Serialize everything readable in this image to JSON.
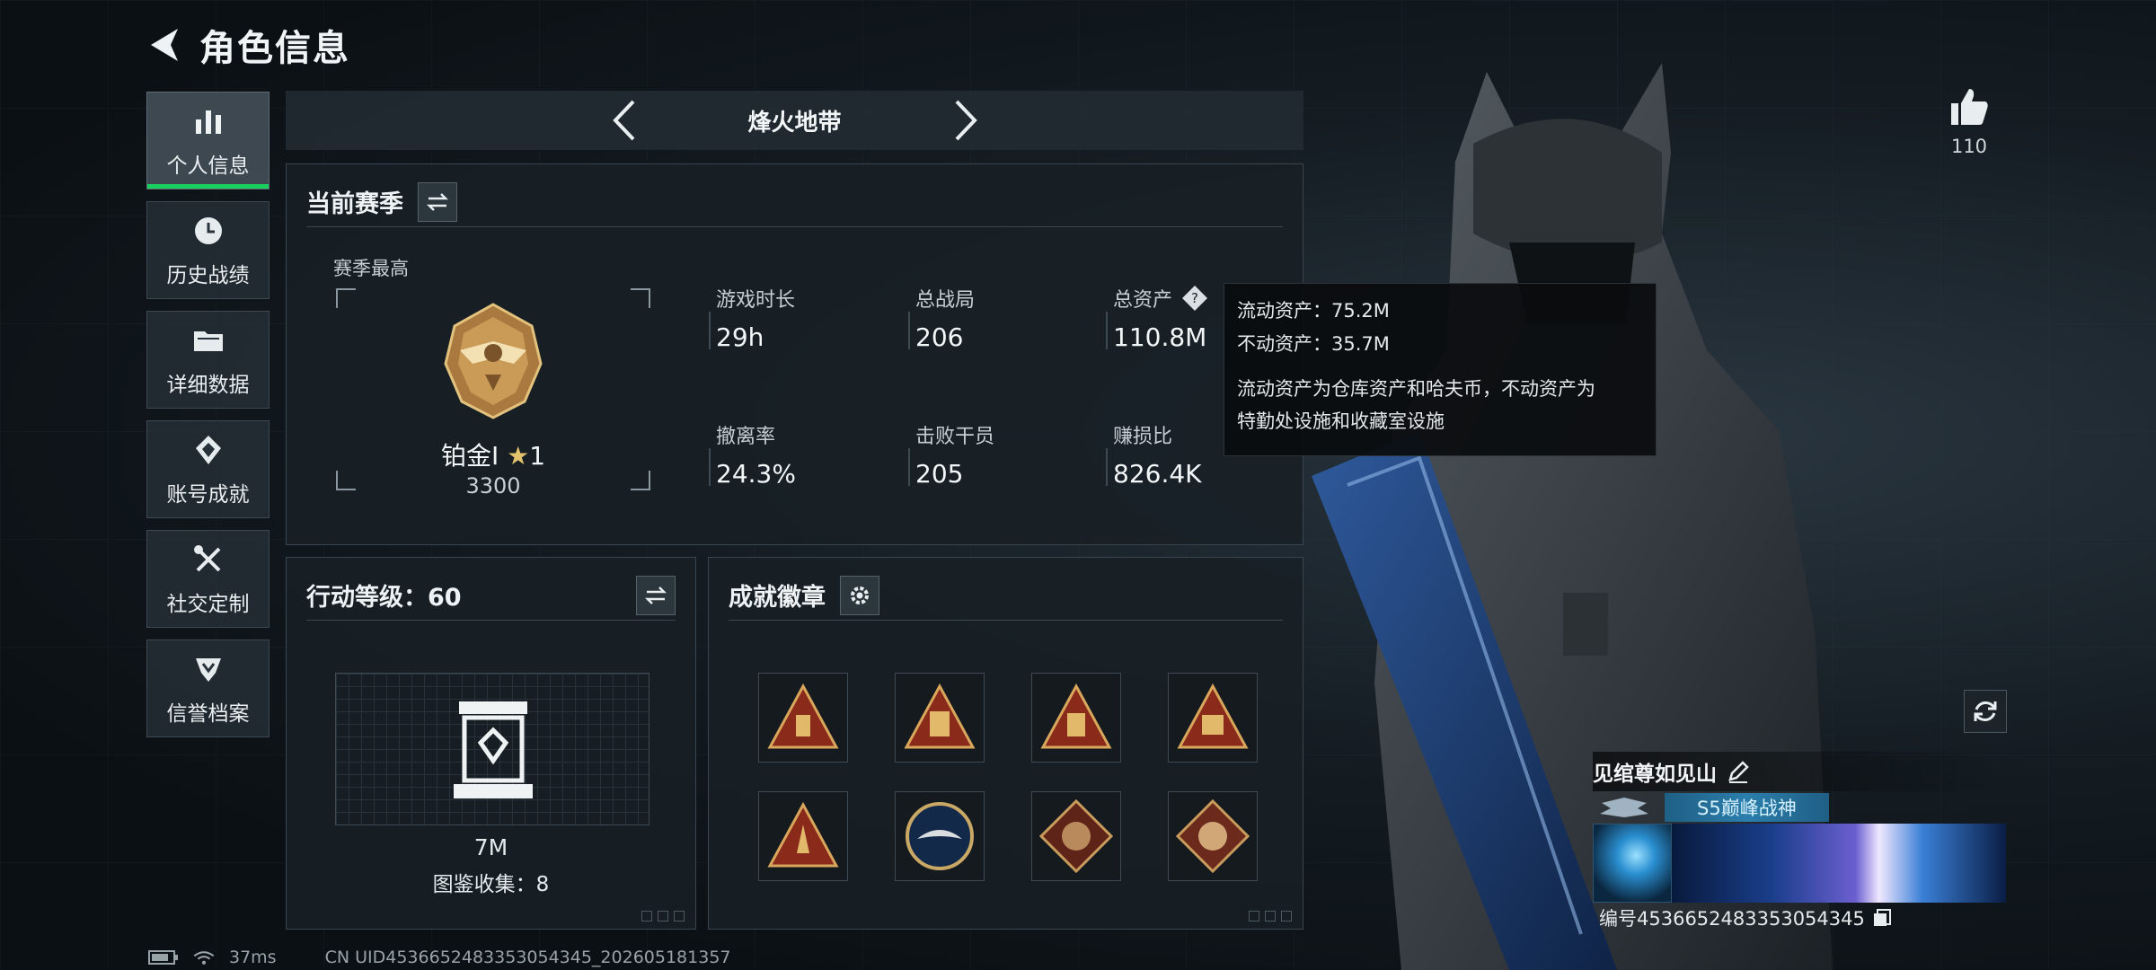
{
  "page": {
    "title": "角色信息"
  },
  "sidebar": {
    "items": [
      {
        "label": "个人信息",
        "icon": "bar-chart-icon",
        "active": true
      },
      {
        "label": "历史战绩",
        "icon": "clock-icon"
      },
      {
        "label": "详细数据",
        "icon": "folder-icon"
      },
      {
        "label": "账号成就",
        "icon": "achievement-icon"
      },
      {
        "label": "社交定制",
        "icon": "tools-icon"
      },
      {
        "label": "信誉档案",
        "icon": "shield-check-icon"
      }
    ]
  },
  "mode": {
    "name": "烽火地带"
  },
  "season": {
    "title": "当前赛季",
    "best_label": "赛季最高",
    "rank": {
      "name": "铂金Ⅰ",
      "star": "★",
      "stars": "1",
      "score": "3300"
    },
    "stats": [
      {
        "label": "游戏时长",
        "value": "29h"
      },
      {
        "label": "总战局",
        "value": "206"
      },
      {
        "label": "总资产",
        "value": "110.8M"
      },
      {
        "label": "撤离率",
        "value": "24.3%"
      },
      {
        "label": "击败干员",
        "value": "205"
      },
      {
        "label": "赚损比",
        "value": "826.4K"
      }
    ]
  },
  "tooltip": {
    "liquid": "流动资产：75.2M",
    "fixed": "不动资产：35.7M",
    "note_line1": "流动资产为仓库资产和哈夫币，不动资产为",
    "note_line2": "特勤处设施和收藏室设施"
  },
  "level": {
    "title": "行动等级：60",
    "value": "7M",
    "collection": "图鉴收集：8"
  },
  "badges": {
    "title": "成就徽章",
    "items": [
      {
        "icon": "triangle-badge-icon"
      },
      {
        "icon": "triangle-badge-icon"
      },
      {
        "icon": "triangle-badge-icon"
      },
      {
        "icon": "triangle-badge-icon"
      },
      {
        "icon": "triangle-badge-icon"
      },
      {
        "icon": "eagle-emblem-icon"
      },
      {
        "icon": "diamond-badge-icon"
      },
      {
        "icon": "diamond-badge-icon"
      }
    ]
  },
  "profile": {
    "likes": "110",
    "nickname": "见绾尊如见山",
    "title": "S5巅峰战神",
    "uid": "编号453665248335305434​5"
  },
  "status": {
    "ping": "37ms",
    "uid_line": "CN UID4536652483353054345_202605181357"
  },
  "colors": {
    "accent": "#19d05f",
    "gold": "#e2c26c"
  }
}
